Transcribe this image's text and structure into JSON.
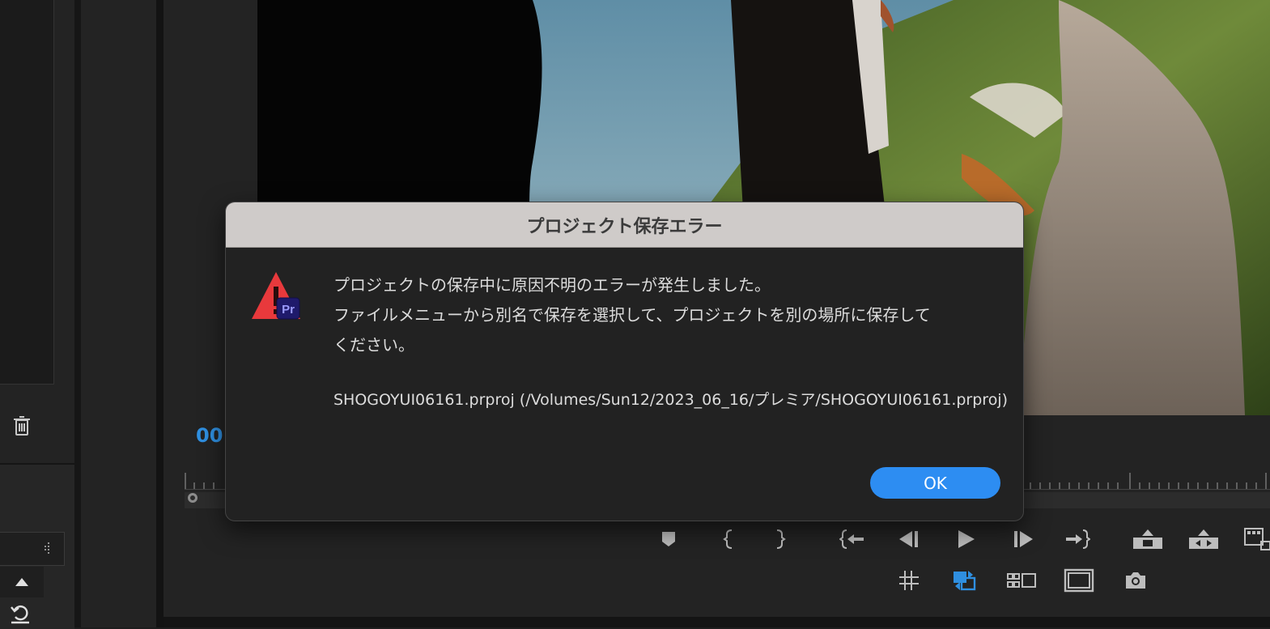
{
  "dialog": {
    "title": "プロジェクト保存エラー",
    "message_line1": "プロジェクトの保存中に原因不明のエラーが発生しました。",
    "message_line2": "ファイルメニューから別名で保存を選択して、プロジェクトを別の場所に保存して",
    "message_line3": "ください。",
    "path": "SHOGOYUI06161.prproj (/Volumes/Sun12/2023_06_16/プレミア/SHOGOYUI06161.prproj)",
    "ok_label": "OK",
    "app_badge": "Pr"
  },
  "monitor": {
    "timecode_partial": "00:"
  },
  "colors": {
    "accent": "#2d8df2",
    "timecode": "#2f8fe0",
    "warning": "#e8393c",
    "badge_bg": "#1f1a6b"
  },
  "icons": {
    "trash": "trash-icon",
    "warning": "warning-icon",
    "marker": "marker-icon",
    "mark_in": "mark-in-icon",
    "mark_out": "mark-out-icon",
    "go_to_in": "go-to-in-icon",
    "step_back": "step-back-icon",
    "play": "play-icon",
    "step_forward": "step-forward-icon",
    "go_to_out": "go-to-out-icon",
    "lift": "lift-icon",
    "extract": "extract-icon",
    "export_frame": "export-frame-icon"
  }
}
